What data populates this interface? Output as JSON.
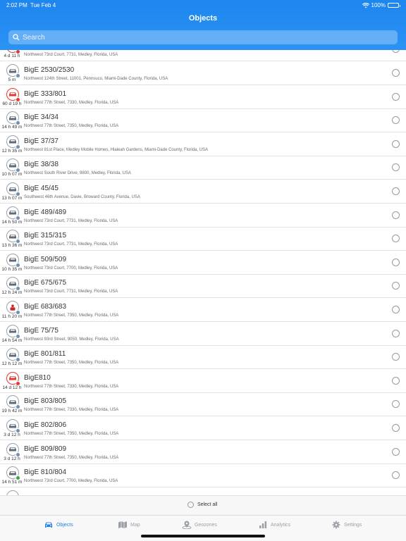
{
  "status": {
    "time": "2:02 PM",
    "date": "Tue Feb 4",
    "battery": "100%"
  },
  "header": {
    "title": "Objects"
  },
  "search": {
    "placeholder": "Search"
  },
  "partial_row": {
    "time": "4 d 11 h",
    "address": "Northwest 73rd Court, 7731, Medley, Florida, USA"
  },
  "rows": [
    {
      "name": "BigE 2530/2530",
      "time": "5 m",
      "address": "Northwest 124th Street, 11001, Pennsuco, Miami-Dade County, Florida, USA"
    },
    {
      "name": "BigE 333/801",
      "time": "60 d 19 h",
      "address": "Northwest 77th Street, 7330, Medley, Florida, USA"
    },
    {
      "name": "BigE 34/34",
      "time": "14 h 49 m",
      "address": "Northwest 77th Street, 7350, Medley, Florida, USA"
    },
    {
      "name": "BigE 37/37",
      "time": "12 h 35 m",
      "address": "Northwest 81st Place, Medley Mobile Homes, Hialeah Gardens, Miami-Dade County, Florida, USA"
    },
    {
      "name": "BigE 38/38",
      "time": "10 h 07 m",
      "address": "Northwest South River Drive, 9800, Medley, Florida, USA"
    },
    {
      "name": "BigE 45/45",
      "time": "13 h 07 m",
      "address": "Southwest 46th Avenue, Davie, Broward County, Florida, USA"
    },
    {
      "name": "BigE 489/489",
      "time": "14 h 50 m",
      "address": "Northwest 73rd Court, 7731, Medley, Florida, USA"
    },
    {
      "name": "BigE 315/315",
      "time": "13 h 36 m",
      "address": "Northwest 73rd Court, 7731, Medley, Florida, USA"
    },
    {
      "name": "BigE 509/509",
      "time": "10 h 35 m",
      "address": "Northwest 73rd Court, 7700, Medley, Florida, USA"
    },
    {
      "name": "BigE 675/675",
      "time": "12 h 24 m",
      "address": "Northwest 73rd Court, 7731, Medley, Florida, USA"
    },
    {
      "name": "BigE 683/683",
      "time": "11 h 20 m",
      "address": "Northwest 77th Street, 7350, Medley, Florida, USA"
    },
    {
      "name": "BigE 75/75",
      "time": "14 h 54 m",
      "address": "Northwest 93rd Street, 9050, Medley, Florida, USA"
    },
    {
      "name": "BigE 801/811",
      "time": "12 h 12 m",
      "address": "Northwest 77th Street, 7350, Medley, Florida, USA"
    },
    {
      "name": "BigE810",
      "time": "14 d 12 h",
      "address": "Northwest 77th Street, 7330, Medley, Florida, USA"
    },
    {
      "name": "BigE 803/805",
      "time": "19 h 42 m",
      "address": "Northwest 77th Street, 7330, Medley, Florida, USA"
    },
    {
      "name": "BigE 802/806",
      "time": "3 d 12 h",
      "address": "Northwest 77th Street, 7350, Medley, Florida, USA"
    },
    {
      "name": "BigE 809/809",
      "time": "3 d 12 h",
      "address": "Northwest 77th Street, 7350, Medley, Florida, USA"
    },
    {
      "name": "BigE 810/804",
      "time": "14 h 51 m",
      "address": "Northwest 73rd Court, 7700, Medley, Florida, USA"
    }
  ],
  "select_all": "Select all",
  "tabs": {
    "objects": "Objects",
    "map": "Map",
    "geozones": "Geozones",
    "analytics": "Analytics",
    "settings": "Settings"
  },
  "colors": {
    "accent": "#1e7ee6",
    "header": "#2b93f3",
    "alert": "#e53935",
    "status_dot": "#6f8fb4"
  }
}
